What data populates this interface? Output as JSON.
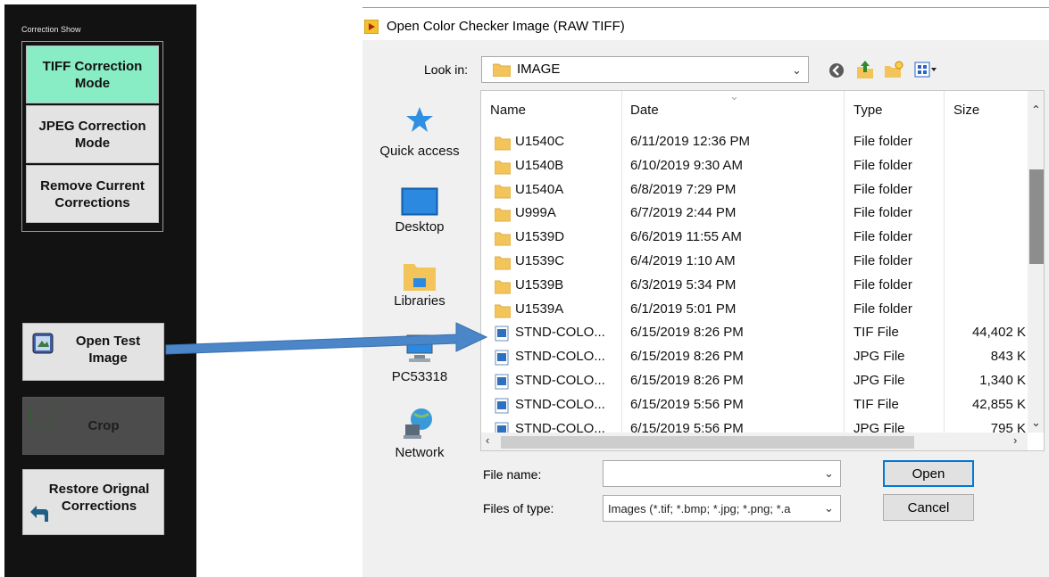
{
  "left_panel": {
    "label": "Correction Show",
    "mode_buttons": [
      {
        "label": "TIFF Correction Mode",
        "active": true
      },
      {
        "label": "JPEG Correction Mode",
        "active": false
      },
      {
        "label": "Remove Current Corrections",
        "active": false
      }
    ],
    "open_test_image": "Open Test Image",
    "crop": "Crop",
    "restore": "Restore Orignal Corrections"
  },
  "dialog": {
    "title": "Open Color Checker Image (RAW TIFF)",
    "look_in_label": "Look in:",
    "look_in_value": "IMAGE",
    "places": [
      "Quick access",
      "Desktop",
      "Libraries",
      "PC53318",
      "Network"
    ],
    "columns": [
      "Name",
      "Date",
      "Type",
      "Size"
    ],
    "files": [
      {
        "name": "U1540C",
        "date": "6/11/2019 12:36 PM",
        "type": "File folder",
        "size": "",
        "icon": "folder-icon"
      },
      {
        "name": "U1540B",
        "date": "6/10/2019 9:30 AM",
        "type": "File folder",
        "size": "",
        "icon": "folder-icon"
      },
      {
        "name": "U1540A",
        "date": "6/8/2019 7:29 PM",
        "type": "File folder",
        "size": "",
        "icon": "folder-icon"
      },
      {
        "name": "U999A",
        "date": "6/7/2019 2:44 PM",
        "type": "File folder",
        "size": "",
        "icon": "folder-icon"
      },
      {
        "name": "U1539D",
        "date": "6/6/2019 11:55 AM",
        "type": "File folder",
        "size": "",
        "icon": "folder-icon"
      },
      {
        "name": "U1539C",
        "date": "6/4/2019 1:10 AM",
        "type": "File folder",
        "size": "",
        "icon": "folder-icon"
      },
      {
        "name": "U1539B",
        "date": "6/3/2019 5:34 PM",
        "type": "File folder",
        "size": "",
        "icon": "folder-icon"
      },
      {
        "name": "U1539A",
        "date": "6/1/2019 5:01 PM",
        "type": "File folder",
        "size": "",
        "icon": "folder-icon"
      },
      {
        "name": "STND-COLO...",
        "date": "6/15/2019 8:26 PM",
        "type": "TIF File",
        "size": "44,402 K",
        "icon": "image-file-icon"
      },
      {
        "name": "STND-COLO...",
        "date": "6/15/2019 8:26 PM",
        "type": "JPG File",
        "size": "843 K",
        "icon": "image-file-icon"
      },
      {
        "name": "STND-COLO...",
        "date": "6/15/2019 8:26 PM",
        "type": "JPG File",
        "size": "1,340 K",
        "icon": "image-file-icon"
      },
      {
        "name": "STND-COLO...",
        "date": "6/15/2019 5:56 PM",
        "type": "TIF File",
        "size": "42,855 K",
        "icon": "image-file-icon"
      },
      {
        "name": "STND-COLO...",
        "date": "6/15/2019 5:56 PM",
        "type": "JPG File",
        "size": "795 K",
        "icon": "image-file-icon"
      }
    ],
    "file_name_label": "File name:",
    "file_name_value": "",
    "file_type_label": "Files of type:",
    "file_type_value": "Images (*.tif; *.bmp; *.jpg; *.png; *.a",
    "open_button": "Open",
    "cancel_button": "Cancel"
  },
  "colors": {
    "active_mode": "#88ecc5",
    "panel_bg": "#121212",
    "folder": "#f2c45a",
    "arrow": "#4a86c8",
    "accent": "#0078d7"
  }
}
